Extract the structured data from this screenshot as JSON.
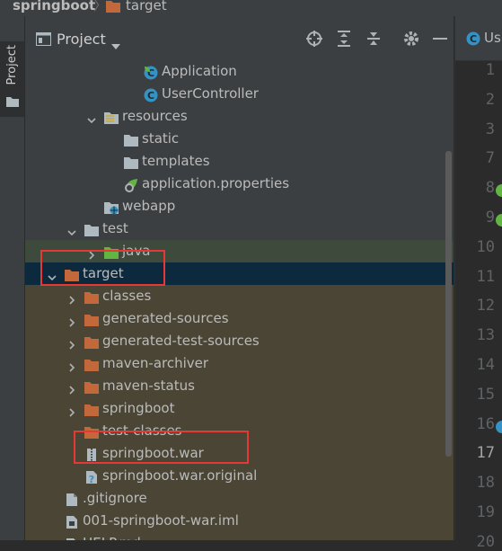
{
  "breadcrumb": {
    "root": "springboot",
    "current": "target"
  },
  "toolwindow": {
    "side_tab_label": "Project",
    "title": "Project"
  },
  "header_icons": [
    "crosshair-icon",
    "expand-all-icon",
    "collapse-all-icon",
    "gear-icon",
    "minimize-icon"
  ],
  "tree": [
    {
      "label": "Application",
      "icon": "spring-class-icon",
      "depth": 6,
      "arrow": "none"
    },
    {
      "label": "UserController",
      "icon": "class-icon",
      "depth": 6,
      "arrow": "none"
    },
    {
      "label": "resources",
      "icon": "resources-folder-icon",
      "depth": 4,
      "arrow": "down"
    },
    {
      "label": "static",
      "icon": "folder-icon",
      "depth": 5,
      "arrow": "none"
    },
    {
      "label": "templates",
      "icon": "folder-icon",
      "depth": 5,
      "arrow": "none"
    },
    {
      "label": "application.properties",
      "icon": "spring-properties-icon",
      "depth": 5,
      "arrow": "none"
    },
    {
      "label": "webapp",
      "icon": "web-folder-icon",
      "depth": 4,
      "arrow": "none"
    },
    {
      "label": "test",
      "icon": "folder-icon",
      "depth": 3,
      "arrow": "down"
    },
    {
      "label": "java",
      "icon": "green-folder-icon",
      "depth": 4,
      "arrow": "right"
    },
    {
      "label": "target",
      "icon": "orange-folder-icon",
      "depth": 2,
      "arrow": "down"
    },
    {
      "label": "classes",
      "icon": "orange-folder-icon",
      "depth": 3,
      "arrow": "right"
    },
    {
      "label": "generated-sources",
      "icon": "orange-folder-icon",
      "depth": 3,
      "arrow": "right"
    },
    {
      "label": "generated-test-sources",
      "icon": "orange-folder-icon",
      "depth": 3,
      "arrow": "right"
    },
    {
      "label": "maven-archiver",
      "icon": "orange-folder-icon",
      "depth": 3,
      "arrow": "right"
    },
    {
      "label": "maven-status",
      "icon": "orange-folder-icon",
      "depth": 3,
      "arrow": "right"
    },
    {
      "label": "springboot",
      "icon": "orange-folder-icon",
      "depth": 3,
      "arrow": "right"
    },
    {
      "label": "test-classes",
      "icon": "orange-folder-icon",
      "depth": 3,
      "arrow": "none"
    },
    {
      "label": "springboot.war",
      "icon": "archive-icon",
      "depth": 3,
      "arrow": "none"
    },
    {
      "label": "springboot.war.original",
      "icon": "unknown-file-icon",
      "depth": 3,
      "arrow": "none"
    },
    {
      "label": ".gitignore",
      "icon": "file-icon",
      "depth": 2,
      "arrow": "none"
    },
    {
      "label": "001-springboot-war.iml",
      "icon": "module-file-icon",
      "depth": 2,
      "arrow": "none"
    },
    {
      "label": "HELP.md",
      "icon": "markdown-file-icon",
      "depth": 2,
      "arrow": "none"
    }
  ],
  "editor": {
    "tab_label": "Us",
    "line_numbers": [
      "1",
      "2",
      "3",
      "7",
      "8",
      "9",
      "10",
      "11",
      "12",
      "13",
      "14",
      "15",
      "16",
      "17",
      "18",
      "19",
      "20"
    ],
    "current_line": "17"
  },
  "colors": {
    "panel_bg": "#3c3f41",
    "selection_target": "#0d293e",
    "selection_secondary": "#4a4535",
    "annotation_red": "#e53935",
    "folder_orange": "#c2683a",
    "folder_gray": "#aeb9c0",
    "folder_green": "#62b543",
    "class_blue": "#3592c4"
  }
}
